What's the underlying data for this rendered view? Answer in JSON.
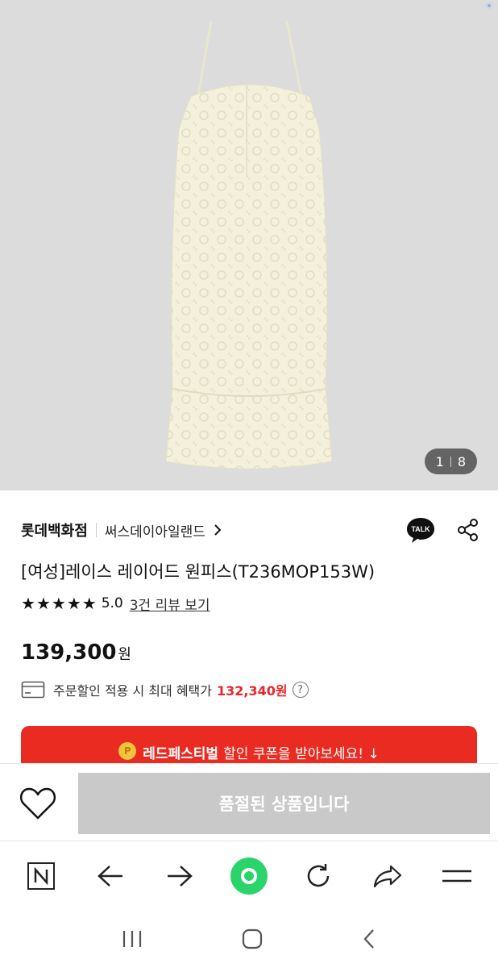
{
  "gallery": {
    "current": "1",
    "total": "8"
  },
  "product": {
    "brand": "롯데백화점",
    "sub_brand": "써스데이아일랜드",
    "title": "[여성]레이스 레이어드 원피스(T236MOP153W)",
    "rating": "5.0",
    "stars": 5,
    "review_link": "3건 리뷰 보기",
    "price": "139,300",
    "currency": "원",
    "benefit_text": "주문할인 적용 시 최대 혜택가",
    "benefit_price": "132,340원",
    "help_mark": "?"
  },
  "coupon": {
    "strong": "레드페스티벌",
    "text": "할인 쿠폰을 받아보세요! ↓",
    "coin_mark": "P"
  },
  "talk_label": "TALK",
  "action": {
    "soldout_label": "품절된 상품입니다"
  },
  "colors": {
    "accent_red": "#ea2b21",
    "price_red": "#e8262c",
    "naver_green": "#03c75a",
    "disabled_gray": "#c9c9c9"
  },
  "browser_bar": {
    "icons": [
      "naver-n-icon",
      "back-arrow-icon",
      "forward-arrow-icon",
      "green-dot-icon",
      "refresh-icon",
      "share-forward-icon",
      "menu-icon"
    ]
  },
  "android_nav": {
    "icons": [
      "recent-apps-icon",
      "home-icon",
      "back-icon"
    ]
  }
}
